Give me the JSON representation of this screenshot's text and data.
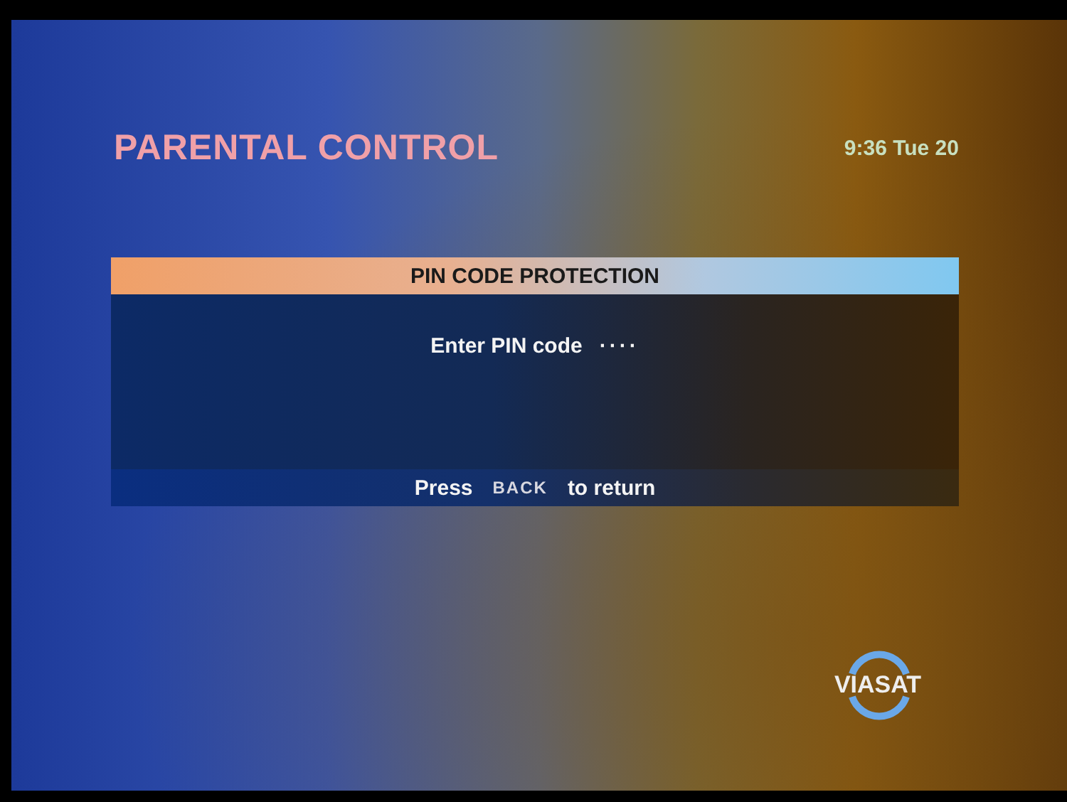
{
  "header": {
    "title": "PARENTAL CONTROL",
    "clock": "9:36 Tue 20"
  },
  "dialog": {
    "title": "PIN CODE PROTECTION",
    "prompt": "Enter PIN code",
    "pin_value": "····",
    "footer": {
      "before": "Press",
      "key": "BACK",
      "after": "to return"
    }
  },
  "logo": {
    "text": "VIASAT"
  }
}
